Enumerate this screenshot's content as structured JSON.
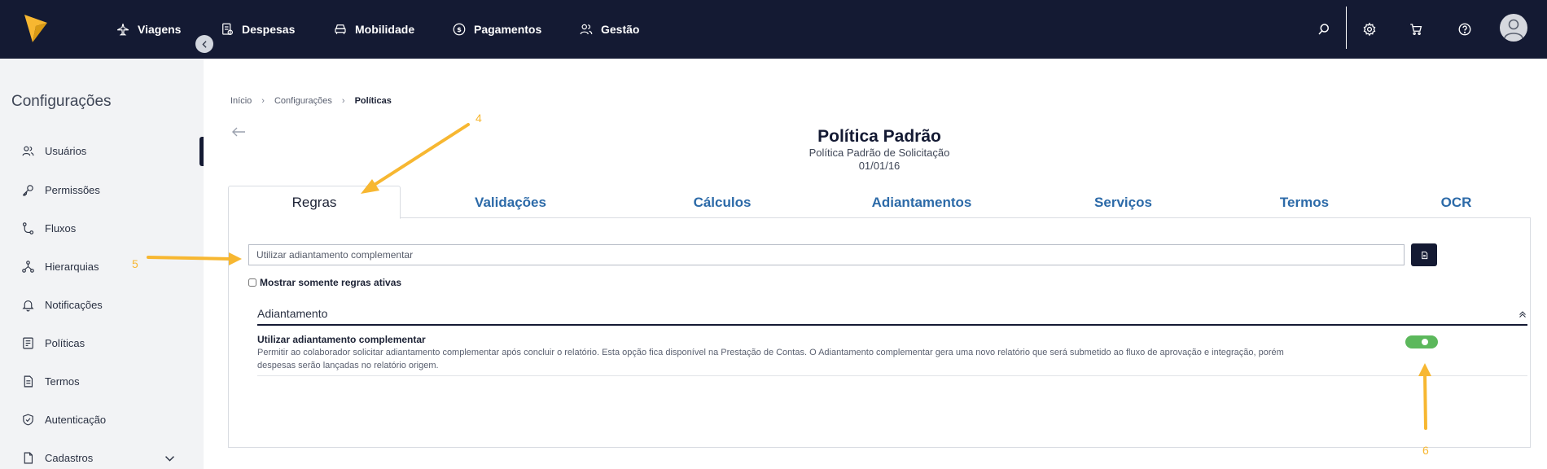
{
  "app": {
    "nav": [
      {
        "label": "Viagens",
        "icon": "airplane-icon"
      },
      {
        "label": "Despesas",
        "icon": "receipt-icon"
      },
      {
        "label": "Mobilidade",
        "icon": "car-icon"
      },
      {
        "label": "Pagamentos",
        "icon": "dollar-icon"
      },
      {
        "label": "Gestão",
        "icon": "users-icon"
      }
    ],
    "top_icons": [
      "search-icon",
      "gear-icon",
      "cart-icon",
      "help-icon",
      "avatar-icon"
    ]
  },
  "sidebar": {
    "title": "Configurações",
    "items": [
      {
        "label": "Usuários",
        "icon": "users-icon"
      },
      {
        "label": "Permissões",
        "icon": "key-icon"
      },
      {
        "label": "Fluxos",
        "icon": "flow-icon"
      },
      {
        "label": "Hierarquias",
        "icon": "hierarchy-icon"
      },
      {
        "label": "Notificações",
        "icon": "bell-icon"
      },
      {
        "label": "Políticas",
        "icon": "policy-icon"
      },
      {
        "label": "Termos",
        "icon": "document-icon"
      },
      {
        "label": "Autenticação",
        "icon": "shield-icon"
      },
      {
        "label": "Cadastros",
        "icon": "file-icon"
      }
    ]
  },
  "breadcrumb": {
    "items": [
      "Início",
      "Configurações",
      "Políticas"
    ]
  },
  "header": {
    "title": "Política Padrão",
    "subtitle": "Política Padrão de Solicitação",
    "date": "01/01/16"
  },
  "tabs": [
    {
      "label": "Regras",
      "active": true
    },
    {
      "label": "Validações"
    },
    {
      "label": "Cálculos"
    },
    {
      "label": "Adiantamentos"
    },
    {
      "label": "Serviços"
    },
    {
      "label": "Termos"
    },
    {
      "label": "OCR"
    }
  ],
  "rules": {
    "search_value": "Utilizar adiantamento complementar",
    "only_active_label": "Mostrar somente regras ativas",
    "only_active_checked": false,
    "section_title": "Adiantamento",
    "rule_title": "Utilizar adiantamento complementar",
    "rule_description": "Permitir ao colaborador solicitar adiantamento complementar após concluir o relatório. Esta opção fica disponível na Prestação de Contas. O Adiantamento complementar gera uma novo relatório que será submetido ao fluxo de aprovação e integração, porém despesas serão lançadas no relatório origem.",
    "rule_enabled": true
  },
  "annotations": [
    "4",
    "5",
    "6"
  ],
  "colors": {
    "topbar": "#141a33",
    "link": "#2c6aa8",
    "toggle_on": "#5cb85c",
    "annotation": "#f7b731",
    "logo": "#f7b731"
  }
}
